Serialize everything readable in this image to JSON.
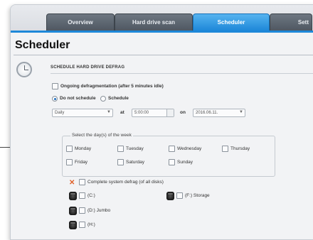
{
  "tabs": [
    {
      "label": "Overview",
      "active": false
    },
    {
      "label": "Hard drive scan",
      "active": false
    },
    {
      "label": "Scheduler",
      "active": true
    },
    {
      "label": "Sett",
      "active": false
    }
  ],
  "page_title": "Scheduler",
  "section": {
    "heading": "SCHEDULE HARD DRIVE DEFRAG"
  },
  "options": {
    "ongoing_label": "Ongoing defragmentation (after 5 minutes idle)",
    "do_not_schedule_label": "Do not schedule",
    "schedule_label": "Schedule",
    "selected_mode": "Do not schedule"
  },
  "schedule_row": {
    "frequency": "Daily",
    "at_label": "at",
    "time": "5:00:00",
    "on_label": "on",
    "date": "2016.06.11."
  },
  "days": {
    "legend": "Select the day(s) of the week",
    "items": [
      "Monday",
      "Tuesday",
      "Wednesday",
      "Thursday",
      "Friday",
      "Saturday",
      "Sunday"
    ]
  },
  "complete_defrag_label": "Complete system defrag (of all disks)",
  "drives": [
    {
      "label": "(C:)"
    },
    {
      "label": "(F:) Storage"
    },
    {
      "label": "(D:) Jumbo"
    },
    {
      "label": "(H:)"
    }
  ],
  "colors": {
    "accent": "#1e88d9",
    "warning": "#e0612a"
  },
  "icons": [
    "clock-icon",
    "defrag-x-icon",
    "hard-drive-icon"
  ]
}
